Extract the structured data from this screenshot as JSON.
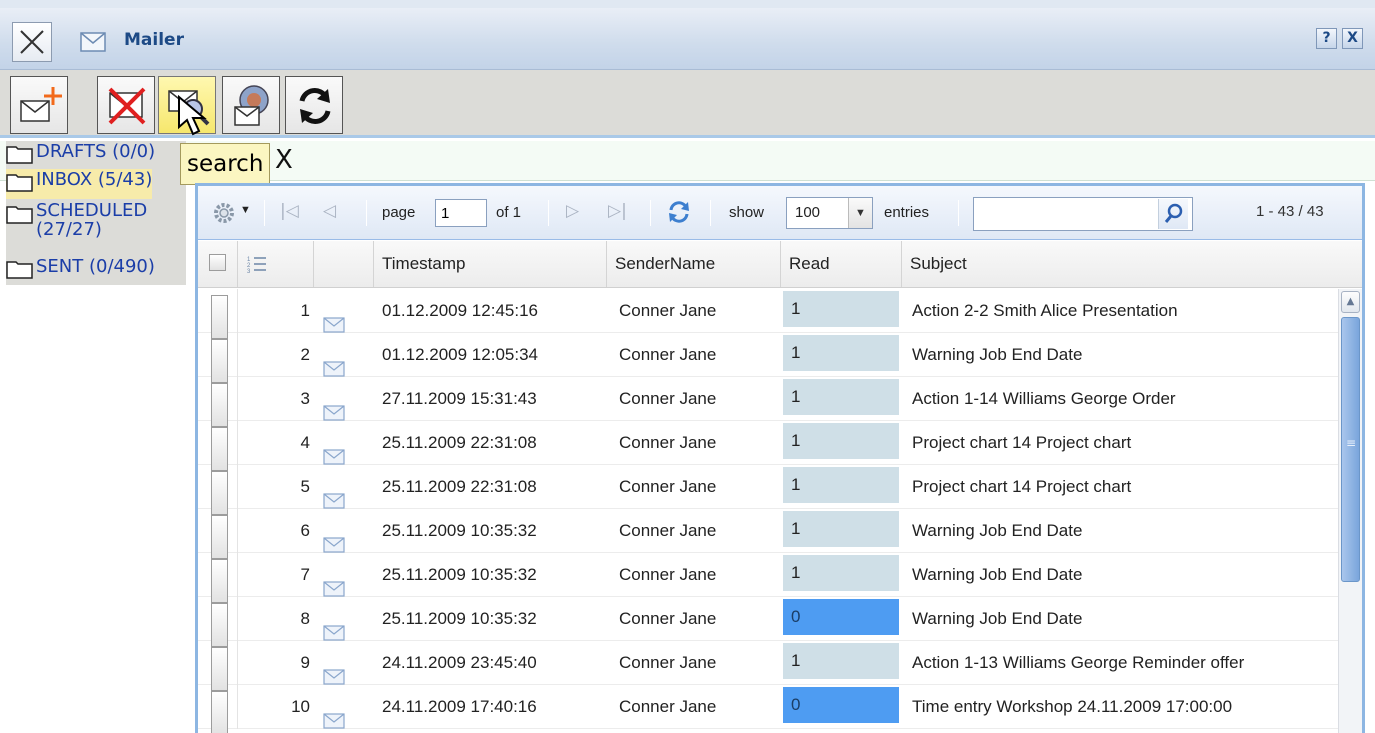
{
  "window": {
    "title": "Mailer",
    "help_label": "?",
    "close_label": "X"
  },
  "toolbar": {
    "new_icon": "new-mail-icon",
    "delete_icon": "delete-mail-icon",
    "search_icon": "search-mail-icon",
    "web_icon": "web-mail-icon",
    "refresh_icon": "refresh-icon"
  },
  "tooltip": "search",
  "search_strip_close": "X",
  "folders": [
    {
      "label": "DRAFTS (0/0)",
      "selected": false
    },
    {
      "label": "INBOX (5/43)",
      "selected": true
    },
    {
      "label": "SCHEDULED (27/27)",
      "selected": false
    },
    {
      "label": "SENT (0/490)",
      "selected": false
    }
  ],
  "pager": {
    "page_label": "page",
    "page_value": "1",
    "of_label": "of 1",
    "show_label": "show",
    "entries_value": "100",
    "entries_label": "entries",
    "search_placeholder": "",
    "count": "1 - 43 / 43"
  },
  "columns": {
    "timestamp": "Timestamp",
    "sender": "SenderName",
    "read": "Read",
    "subject": "Subject"
  },
  "rows": [
    {
      "num": "1",
      "timestamp": "01.12.2009 12:45:16",
      "sender": "Conner Jane",
      "read": "1",
      "subject": "Action 2-2 Smith Alice Presentation"
    },
    {
      "num": "2",
      "timestamp": "01.12.2009 12:05:34",
      "sender": "Conner Jane",
      "read": "1",
      "subject": "Warning Job End Date"
    },
    {
      "num": "3",
      "timestamp": "27.11.2009 15:31:43",
      "sender": "Conner Jane",
      "read": "1",
      "subject": "Action 1-14 Williams George Order"
    },
    {
      "num": "4",
      "timestamp": "25.11.2009 22:31:08",
      "sender": "Conner Jane",
      "read": "1",
      "subject": "Project chart 14 Project chart"
    },
    {
      "num": "5",
      "timestamp": "25.11.2009 22:31:08",
      "sender": "Conner Jane",
      "read": "1",
      "subject": "Project chart 14 Project chart"
    },
    {
      "num": "6",
      "timestamp": "25.11.2009 10:35:32",
      "sender": "Conner Jane",
      "read": "1",
      "subject": "Warning Job End Date"
    },
    {
      "num": "7",
      "timestamp": "25.11.2009 10:35:32",
      "sender": "Conner Jane",
      "read": "1",
      "subject": "Warning Job End Date"
    },
    {
      "num": "8",
      "timestamp": "25.11.2009 10:35:32",
      "sender": "Conner Jane",
      "read": "0",
      "subject": "Warning Job End Date"
    },
    {
      "num": "9",
      "timestamp": "24.11.2009 23:45:40",
      "sender": "Conner Jane",
      "read": "1",
      "subject": "Action 1-13 Williams George Reminder offer"
    },
    {
      "num": "10",
      "timestamp": "24.11.2009 17:40:16",
      "sender": "Conner Jane",
      "read": "0",
      "subject": "Time entry Workshop 24.11.2009 17:00:00"
    }
  ],
  "colors": {
    "accent": "#8db6e2",
    "read_cell": "#cfdfe7",
    "unread_cell": "#4e9cf2",
    "link": "#1b3ea8"
  }
}
